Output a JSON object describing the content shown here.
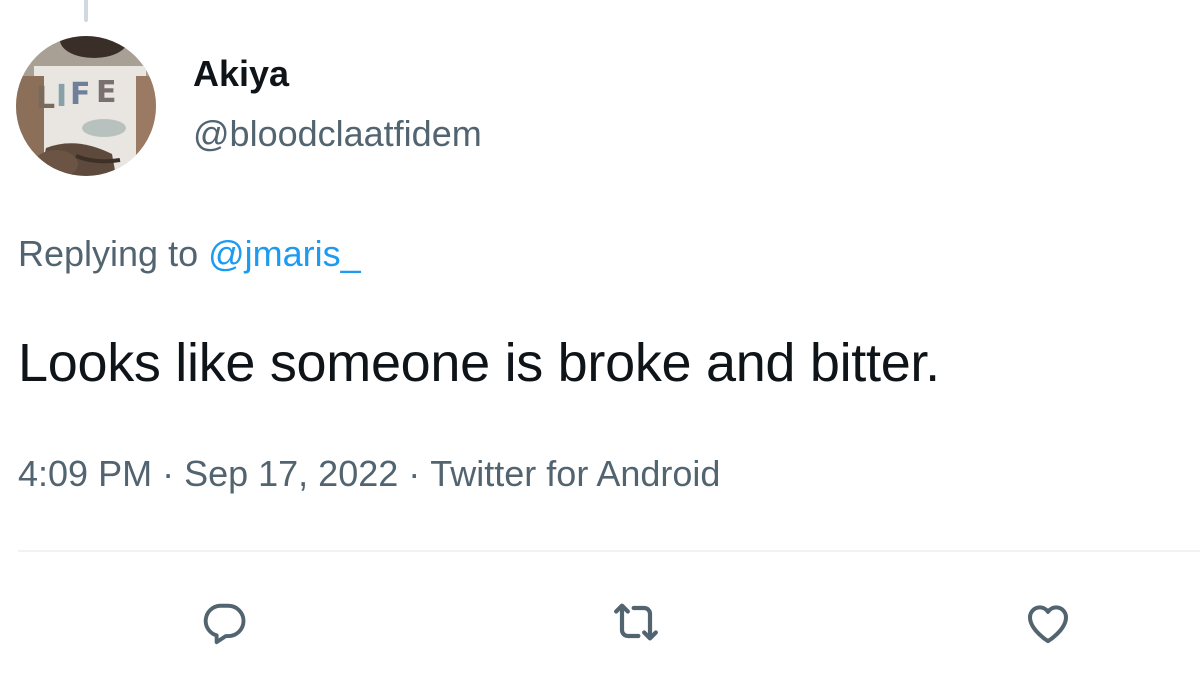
{
  "tweet": {
    "author": {
      "display_name": "Akiya",
      "handle": "@bloodclaatfidem",
      "avatar_shirt_text": "LIFE"
    },
    "reply_context": {
      "prefix": "Replying to",
      "mention": "@jmaris_"
    },
    "text": "Looks like someone is broke and bitter.",
    "meta": {
      "time": "4:09 PM",
      "separator": "·",
      "date": "Sep 17, 2022",
      "source": "Twitter for Android"
    }
  },
  "actions": [
    {
      "name": "reply",
      "icon": "reply-icon"
    },
    {
      "name": "retweet",
      "icon": "retweet-icon"
    },
    {
      "name": "like",
      "icon": "heart-icon"
    }
  ],
  "colors": {
    "text_primary": "#0f1419",
    "text_secondary": "#536471",
    "link": "#1d9bf0",
    "divider": "#eff3f4"
  }
}
